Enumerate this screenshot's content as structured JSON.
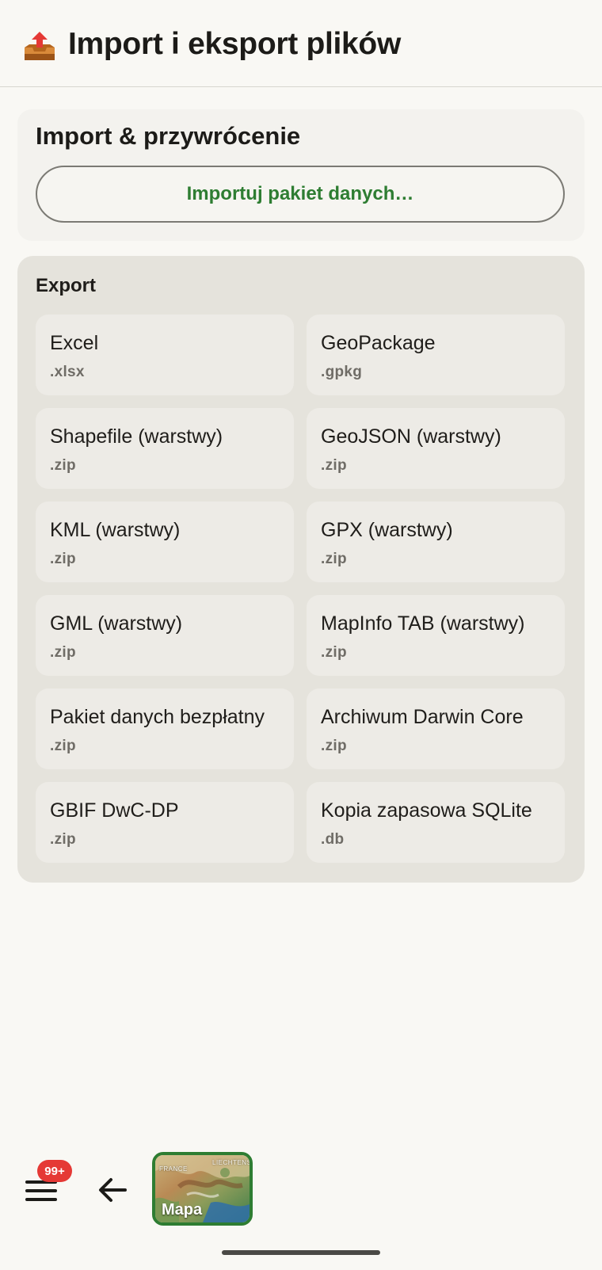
{
  "header": {
    "icon": "outbox-tray-icon",
    "title": "Import i eksport plików"
  },
  "import_section": {
    "title": "Import & przywrócenie",
    "button_label": "Importuj pakiet danych…",
    "accent_color": "#2e7d32"
  },
  "export_section": {
    "title": "Export",
    "items": [
      {
        "name": "Excel",
        "ext": ".xlsx"
      },
      {
        "name": "GeoPackage",
        "ext": ".gpkg"
      },
      {
        "name": "Shapefile (warstwy)",
        "ext": ".zip"
      },
      {
        "name": "GeoJSON (warstwy)",
        "ext": ".zip"
      },
      {
        "name": "KML (warstwy)",
        "ext": ".zip"
      },
      {
        "name": "GPX (warstwy)",
        "ext": ".zip"
      },
      {
        "name": "GML (warstwy)",
        "ext": ".zip"
      },
      {
        "name": "MapInfo TAB (warstwy)",
        "ext": ".zip"
      },
      {
        "name": "Pakiet danych bezpłatny",
        "ext": ".zip"
      },
      {
        "name": "Archiwum Darwin Core",
        "ext": ".zip"
      },
      {
        "name": "GBIF DwC-DP",
        "ext": ".zip"
      },
      {
        "name": "Kopia zapasowa SQLite",
        "ext": ".db"
      }
    ]
  },
  "bottom_nav": {
    "menu_badge": "99+",
    "badge_color": "#e53935",
    "map_label": "Mapa",
    "map_tag_left": "FRANCE",
    "map_tag_right": "LIECHTENS"
  }
}
